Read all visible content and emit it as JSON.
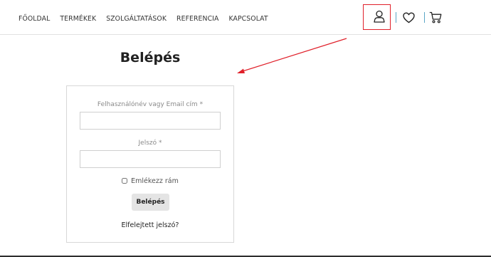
{
  "nav": {
    "items": [
      {
        "label": "FŐOLDAL"
      },
      {
        "label": "TERMÉKEK"
      },
      {
        "label": "SZOLGÁLTATÁSOK"
      },
      {
        "label": "REFERENCIA"
      },
      {
        "label": "KAPCSOLAT"
      }
    ]
  },
  "header_icons": [
    "user-icon",
    "heart-icon",
    "cart-icon"
  ],
  "annotation": {
    "highlight_color": "#e0202a"
  },
  "login": {
    "title": "Belépés",
    "username_label": "Felhasználónév vagy Email cím",
    "username_value": "",
    "password_label": "Jelszó",
    "password_value": "",
    "required_mark": "*",
    "remember_label": "Emlékezz rám",
    "remember_checked": false,
    "submit_label": "Belépés",
    "forgot_label": "Elfelejtett jelszó?"
  }
}
